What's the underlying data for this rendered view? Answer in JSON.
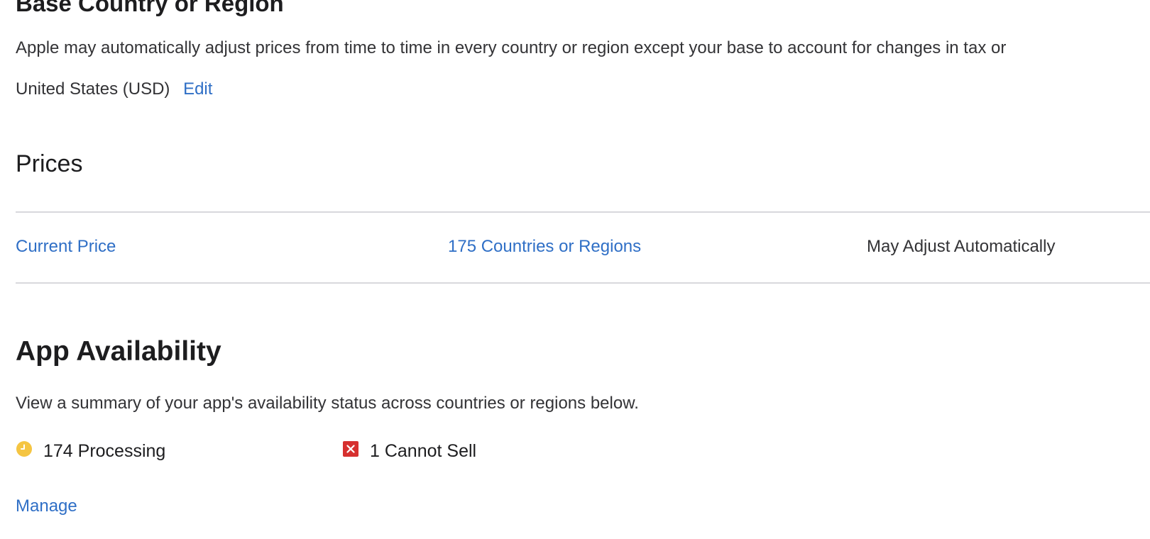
{
  "base": {
    "title": "Base Country or Region",
    "description": "Apple may automatically adjust prices from time to time in every country or region except your base to account for changes in tax or",
    "value": "United States (USD)",
    "edit_label": "Edit"
  },
  "prices": {
    "title": "Prices",
    "row": {
      "price_label": "Current Price",
      "countries_label": "175 Countries or Regions",
      "adjust_label": "May Adjust Automatically"
    }
  },
  "availability": {
    "title": "App Availability",
    "description": "View a summary of your app's availability status across countries or regions below.",
    "statuses": [
      {
        "label": "174 Processing",
        "icon": "clock-icon",
        "color": "#f5c542"
      },
      {
        "label": "1 Cannot Sell",
        "icon": "x-square-icon",
        "color": "#d6302f"
      }
    ],
    "manage_label": "Manage"
  },
  "colors": {
    "link": "#2f6fc6",
    "divider": "#d8d8dc",
    "text": "#1d1d1f"
  }
}
